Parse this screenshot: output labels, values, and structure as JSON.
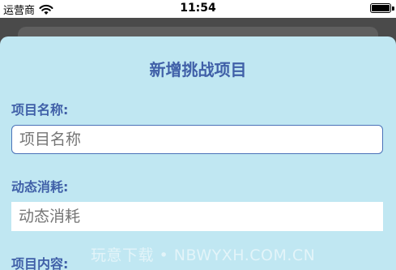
{
  "status_bar": {
    "carrier": "运营商",
    "time": "11:54"
  },
  "sheet": {
    "title": "新增挑战项目"
  },
  "fields": [
    {
      "label": "项目名称:",
      "placeholder": "项目名称"
    },
    {
      "label": "动态消耗:",
      "placeholder": "动态消耗"
    },
    {
      "label": "项目内容:"
    }
  ],
  "watermark": "玩意下载 • NBWYXH.COM.CN"
}
